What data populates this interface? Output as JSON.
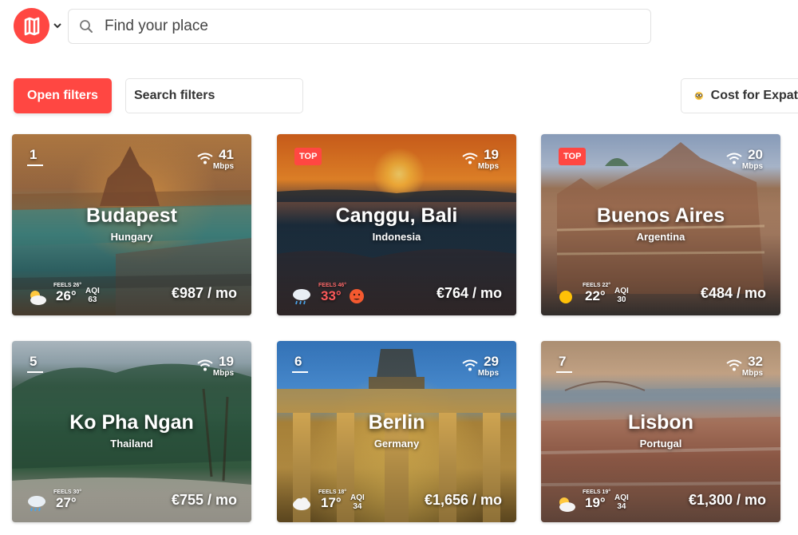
{
  "header": {
    "search_placeholder": "Find your place"
  },
  "filters": {
    "open_label": "Open filters",
    "search_placeholder": "Search filters",
    "sort_label": "Cost for Expat"
  },
  "colors": {
    "brand": "#ff4742"
  },
  "cards": [
    {
      "rank": "1",
      "top": "",
      "city": "Budapest",
      "country": "Hungary",
      "wifi": "41",
      "wifi_unit": "Mbps",
      "feels": "FEELS 26°",
      "temp": "26°",
      "aqi_label": "AQI",
      "aqi": "63",
      "price": "€987 / mo",
      "weather_icon": "partly-cloudy-icon"
    },
    {
      "rank": "",
      "top": "TOP",
      "city": "Canggu, Bali",
      "country": "Indonesia",
      "wifi": "19",
      "wifi_unit": "Mbps",
      "feels": "FEELS 46°",
      "temp": "33°",
      "aqi_label": "",
      "aqi": "",
      "price": "€764 / mo",
      "weather_icon": "rain-cloud-icon"
    },
    {
      "rank": "",
      "top": "TOP",
      "city": "Buenos Aires",
      "country": "Argentina",
      "wifi": "20",
      "wifi_unit": "Mbps",
      "feels": "FEELS 22°",
      "temp": "22°",
      "aqi_label": "AQI",
      "aqi": "30",
      "price": "€484 / mo",
      "weather_icon": "sun-icon"
    },
    {
      "rank": "5",
      "top": "",
      "city": "Ko Pha Ngan",
      "country": "Thailand",
      "wifi": "19",
      "wifi_unit": "Mbps",
      "feels": "FEELS 30°",
      "temp": "27°",
      "aqi_label": "",
      "aqi": "",
      "price": "€755 / mo",
      "weather_icon": "rain-cloud-icon"
    },
    {
      "rank": "6",
      "top": "",
      "city": "Berlin",
      "country": "Germany",
      "wifi": "29",
      "wifi_unit": "Mbps",
      "feels": "FEELS 18°",
      "temp": "17°",
      "aqi_label": "AQI",
      "aqi": "34",
      "price": "€1,656 / mo",
      "weather_icon": "cloud-icon"
    },
    {
      "rank": "7",
      "top": "",
      "city": "Lisbon",
      "country": "Portugal",
      "wifi": "32",
      "wifi_unit": "Mbps",
      "feels": "FEELS 19°",
      "temp": "19°",
      "aqi_label": "AQI",
      "aqi": "34",
      "price": "€1,300 / mo",
      "weather_icon": "partly-cloudy-icon"
    }
  ]
}
